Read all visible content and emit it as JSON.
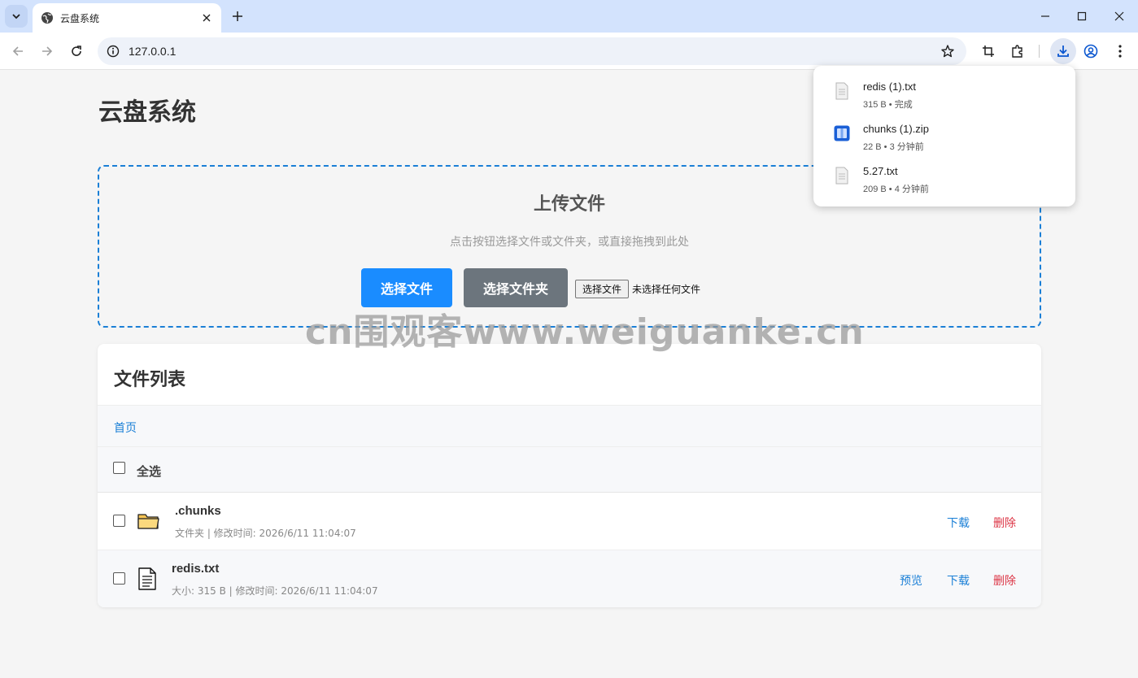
{
  "browser": {
    "tab_title": "云盘系统",
    "url": "127.0.0.1"
  },
  "page": {
    "title": "云盘系统"
  },
  "upload": {
    "title": "上传文件",
    "hint": "点击按钮选择文件或文件夹，或直接拖拽到此处",
    "select_file_label": "选择文件",
    "select_folder_label": "选择文件夹",
    "native_button_label": "选择文件",
    "native_status": "未选择任何文件"
  },
  "watermark": "cn围观客www.weiguanke.cn",
  "file_list": {
    "title": "文件列表",
    "breadcrumb": "首页",
    "select_all": "全选",
    "rows": [
      {
        "name": ".chunks",
        "meta": "文件夹 | 修改时间: 2026/6/11 11:04:07",
        "type": "folder",
        "actions": [
          "下载",
          "删除"
        ]
      },
      {
        "name": "redis.txt",
        "meta": "大小: 315 B | 修改时间: 2026/6/11 11:04:07",
        "type": "file",
        "actions": [
          "预览",
          "下载",
          "删除"
        ]
      }
    ]
  },
  "downloads": {
    "items": [
      {
        "name": "redis (1).txt",
        "meta": "315 B • 完成",
        "icon": "text-file-icon"
      },
      {
        "name": "chunks (1).zip",
        "meta": "22 B • 3 分钟前",
        "icon": "zip-file-icon"
      },
      {
        "name": "5.27.txt",
        "meta": "209 B • 4 分钟前",
        "icon": "text-file-icon"
      }
    ]
  },
  "colors": {
    "primary": "#1a8cff",
    "secondary": "#6c757d",
    "link": "#1a7fd6",
    "danger": "#dc3545",
    "dashed_border": "#1a7fd6"
  }
}
